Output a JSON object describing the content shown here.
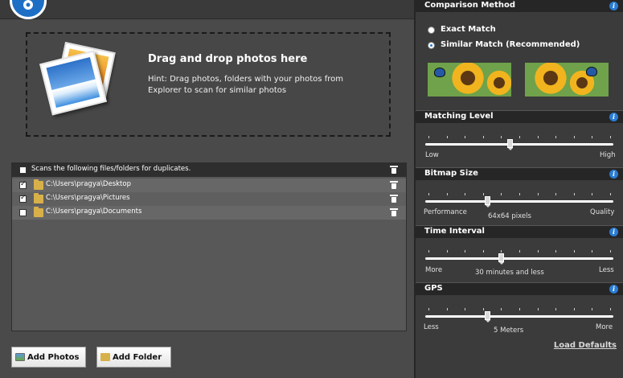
{
  "left": {
    "drop_zone": {
      "title": "Drag and drop photos here",
      "hint": "Hint: Drag photos, folders with your photos from Explorer to scan for similar photos"
    },
    "list": {
      "header": "Scans the following files/folders for duplicates.",
      "items": [
        {
          "path": "C:\\Users\\pragya\\Desktop",
          "checked": true
        },
        {
          "path": "C:\\Users\\pragya\\Pictures",
          "checked": true
        },
        {
          "path": "C:\\Users\\pragya\\Documents",
          "checked": false
        }
      ]
    },
    "buttons": {
      "add_photos": "Add Photos",
      "add_folder": "Add Folder"
    }
  },
  "right": {
    "comparison": {
      "title": "Comparison Method",
      "options": [
        {
          "label": "Exact Match",
          "selected": false
        },
        {
          "label": "Similar Match (Recommended)",
          "selected": true
        }
      ]
    },
    "matching_level": {
      "title": "Matching Level",
      "min_label": "Low",
      "max_label": "High",
      "value": 0.45
    },
    "bitmap_size": {
      "title": "Bitmap Size",
      "min_label": "Performance",
      "value_label": "64x64 pixels",
      "max_label": "Quality",
      "value": 0.33
    },
    "time_interval": {
      "title": "Time Interval",
      "min_label": "More",
      "value_label": "30 minutes and less",
      "max_label": "Less",
      "value": 0.4
    },
    "gps": {
      "title": "GPS",
      "min_label": "Less",
      "value_label": "5 Meters",
      "max_label": "More",
      "value": 0.33
    },
    "load_defaults": "Load Defaults",
    "colors": {
      "accent": "#2a7cd4",
      "panel": "#3b3b3b",
      "header": "#262626"
    }
  }
}
